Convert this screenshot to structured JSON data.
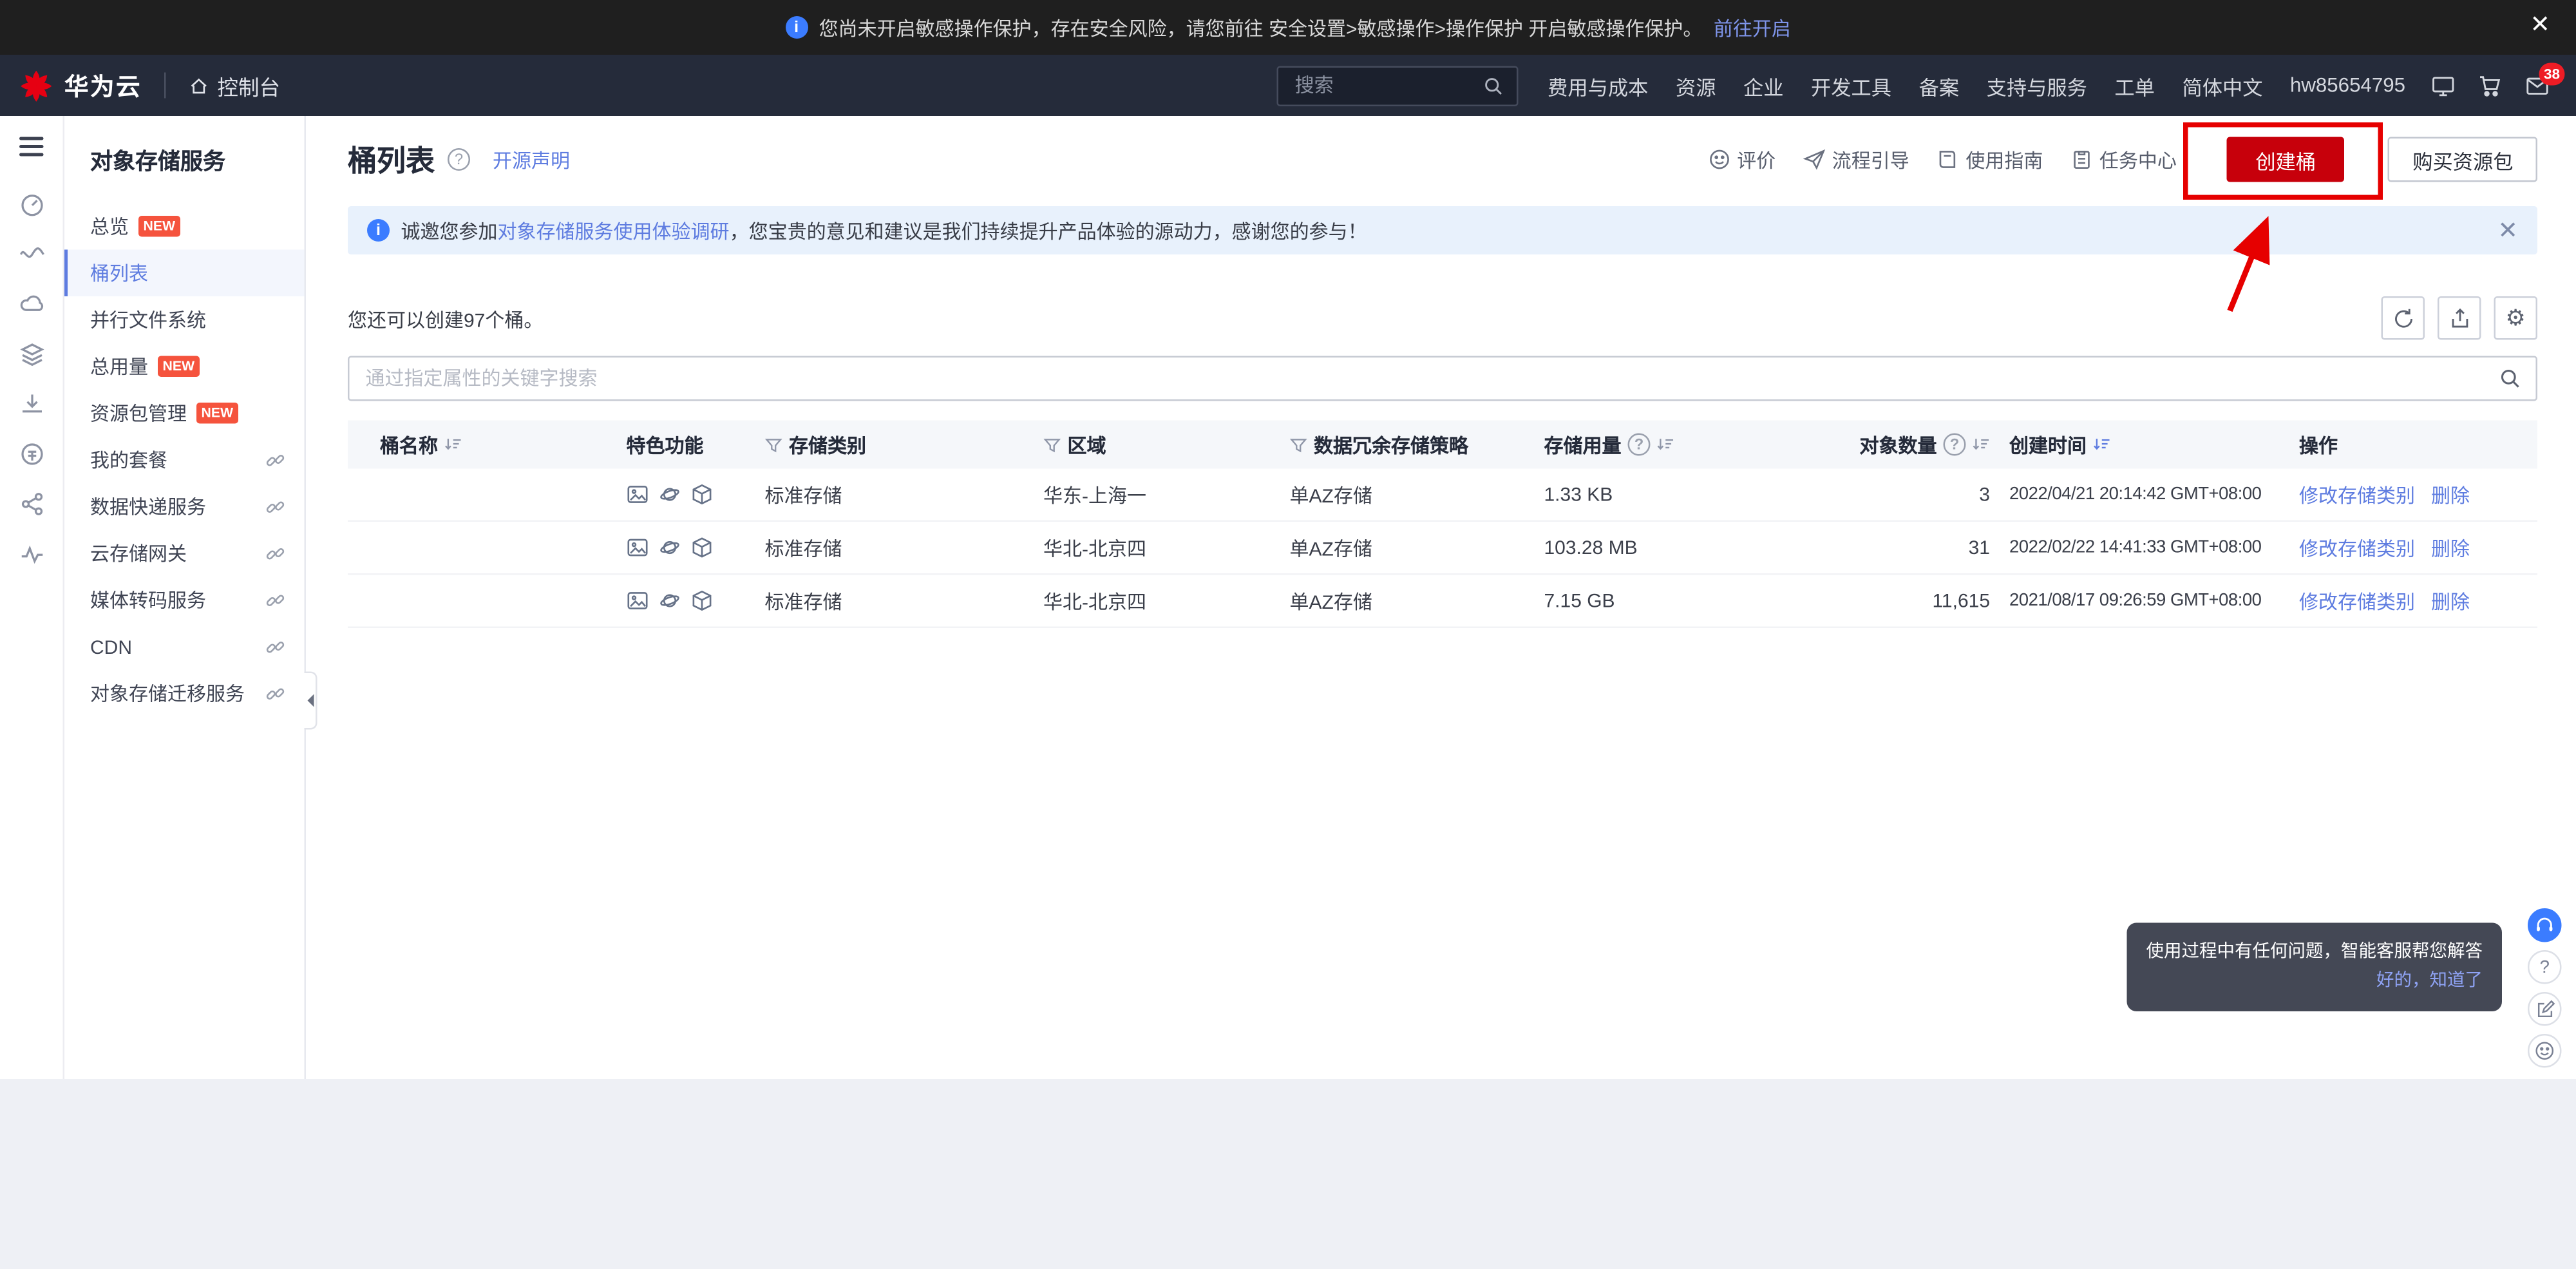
{
  "colors": {
    "brand_red": "#e60012",
    "primary_button_red": "#c7000b",
    "link_blue": "#5e7ce0",
    "banner_bg": "#e8f1fc",
    "new_badge": "#f5533d",
    "annotation_red": "#e60000",
    "header_bg": "#252b3a",
    "notice_bg": "#1f1f1f"
  },
  "notice": {
    "text": "您尚未开启敏感操作保护，存在安全风险，请您前往 安全设置>敏感操作>操作保护 开启敏感操作保护。",
    "link": "前往开启"
  },
  "header": {
    "brand": "华为云",
    "console": "控制台",
    "search_placeholder": "搜索",
    "nav": [
      "费用与成本",
      "资源",
      "企业",
      "开发工具",
      "备案",
      "支持与服务",
      "工单",
      "简体中文",
      "hw85654795"
    ],
    "mail_badge": "38"
  },
  "sidebar": {
    "title": "对象存储服务",
    "items": [
      {
        "label": "总览",
        "badge": "NEW"
      },
      {
        "label": "桶列表"
      },
      {
        "label": "并行文件系统"
      },
      {
        "label": "总用量",
        "badge": "NEW"
      },
      {
        "label": "资源包管理",
        "badge": "NEW"
      },
      {
        "label": "我的套餐"
      },
      {
        "label": "数据快递服务"
      },
      {
        "label": "云存储网关"
      },
      {
        "label": "媒体转码服务"
      },
      {
        "label": "CDN"
      },
      {
        "label": "对象存储迁移服务"
      }
    ]
  },
  "page": {
    "title": "桶列表",
    "opensource_link": "开源声明",
    "toolbar": {
      "rate": "评价",
      "flow_guide": "流程引导",
      "user_guide": "使用指南",
      "task_center": "任务中心",
      "create_bucket": "创建桶",
      "buy_package": "购买资源包"
    },
    "banner": {
      "pre": "诚邀您参加",
      "link": "对象存储服务使用体验调研",
      "post": "，您宝贵的意见和建议是我们持续提升产品体验的源动力，感谢您的参与！"
    },
    "quota": "您还可以创建97个桶。",
    "search_placeholder": "通过指定属性的关键字搜索"
  },
  "table": {
    "cols": [
      "桶名称",
      "特色功能",
      "存储类别",
      "区域",
      "数据冗余存储策略",
      "存储用量",
      "对象数量",
      "创建时间",
      "操作"
    ],
    "actions": {
      "modify": "修改存储类别",
      "delete": "删除"
    },
    "rows": [
      {
        "storage_class": "标准存储",
        "region": "华东-上海一",
        "redundancy": "单AZ存储",
        "usage": "1.33 KB",
        "objects": "3",
        "created": "2022/04/21 20:14:42 GMT+08:00"
      },
      {
        "storage_class": "标准存储",
        "region": "华北-北京四",
        "redundancy": "单AZ存储",
        "usage": "103.28 MB",
        "objects": "31",
        "created": "2022/02/22 14:41:33 GMT+08:00"
      },
      {
        "storage_class": "标准存储",
        "region": "华北-北京四",
        "redundancy": "单AZ存储",
        "usage": "7.15 GB",
        "objects": "11,615",
        "created": "2021/08/17 09:26:59 GMT+08:00"
      }
    ]
  },
  "assistant": {
    "tooltip": "使用过程中有任何问题，智能客服帮您解答",
    "confirm": "好的，知道了"
  },
  "icons": {
    "info": "blue-circle-i",
    "close": "×",
    "search": "magnifier",
    "home": "house",
    "cart": "shopping-cart",
    "mail": "envelope",
    "help": "circle-question",
    "sort": "arrow-with-bars",
    "filter": "funnel",
    "refresh": "circular-arrow",
    "export": "box-with-arrow",
    "settings": "gear",
    "external_link": "chain",
    "collapse": "left-triangle"
  }
}
